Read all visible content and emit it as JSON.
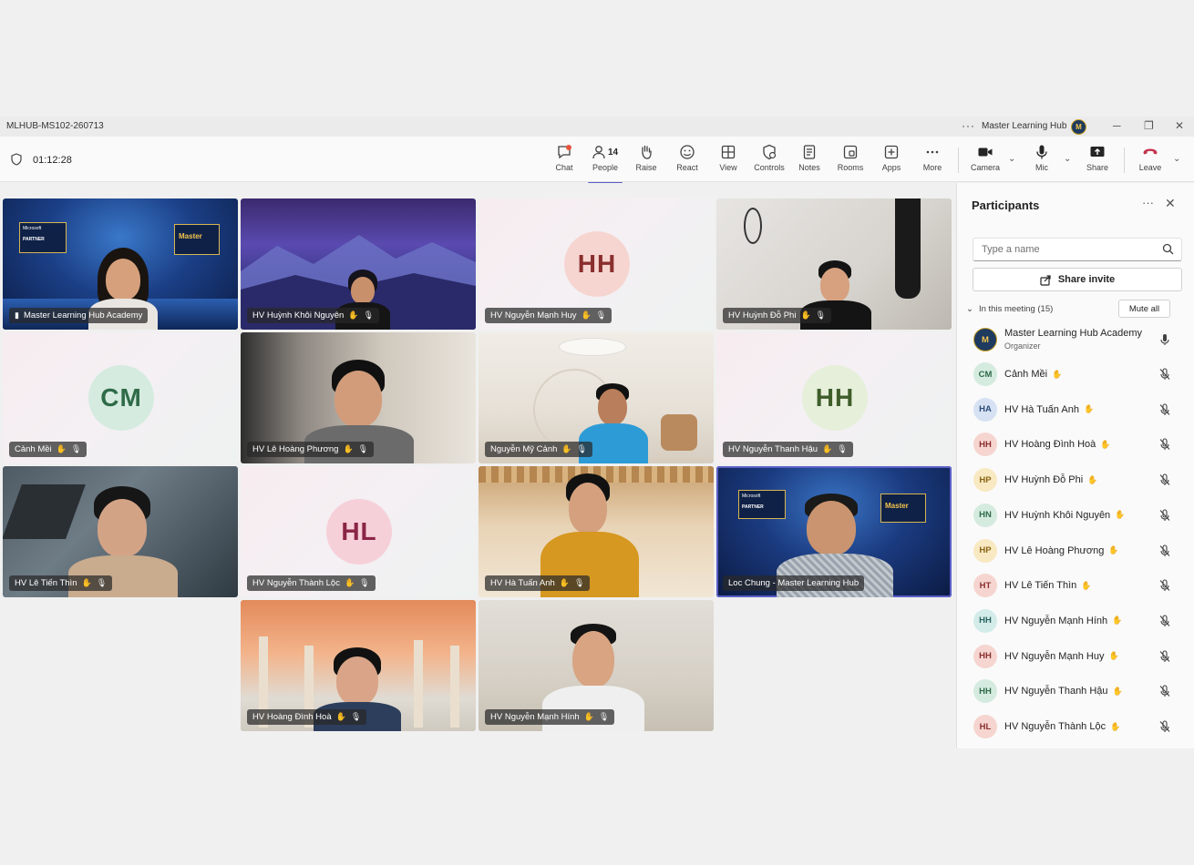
{
  "window": {
    "title": "MLHUB-MS102-260713",
    "org_name": "Master Learning Hub",
    "org_avatar": "M"
  },
  "toolbar": {
    "timer": "01:12:28",
    "buttons": [
      {
        "id": "chat",
        "label": "Chat",
        "icon": "chat-icon"
      },
      {
        "id": "people",
        "label": "People",
        "icon": "people-icon",
        "count": "14"
      },
      {
        "id": "raise",
        "label": "Raise",
        "icon": "hand-icon"
      },
      {
        "id": "react",
        "label": "React",
        "icon": "smile-icon"
      },
      {
        "id": "view",
        "label": "View",
        "icon": "grid-icon"
      },
      {
        "id": "controls",
        "label": "Controls",
        "icon": "controls-icon"
      },
      {
        "id": "notes",
        "label": "Notes",
        "icon": "notes-icon"
      },
      {
        "id": "rooms",
        "label": "Rooms",
        "icon": "rooms-icon"
      },
      {
        "id": "apps",
        "label": "Apps",
        "icon": "apps-icon"
      },
      {
        "id": "more",
        "label": "More",
        "icon": "more-icon"
      },
      {
        "id": "camera",
        "label": "Camera",
        "icon": "camera-icon"
      },
      {
        "id": "mic",
        "label": "Mic",
        "icon": "mic-icon"
      },
      {
        "id": "share",
        "label": "Share",
        "icon": "share-icon"
      },
      {
        "id": "leave",
        "label": "Leave",
        "icon": "phone-hangup-icon"
      }
    ]
  },
  "stage": {
    "tiles": [
      {
        "name": "Master Learning Hub Academy"
      },
      {
        "name": "HV Huỳnh Khôi Nguyên"
      },
      {
        "name": "HV Nguyễn Mạnh Huy",
        "initials": "HH"
      },
      {
        "name": "HV Huỳnh Đỗ Phi"
      },
      {
        "name": "Cảnh Mềi",
        "initials": "CM"
      },
      {
        "name": "HV Lê Hoàng Phương"
      },
      {
        "name": "Nguyễn Mỹ Cảnh"
      },
      {
        "name": "HV Nguyễn Thanh Hậu",
        "initials": "HH"
      },
      {
        "name": "HV Lê Tiến Thìn"
      },
      {
        "name": "HV Nguyễn Thành Lộc",
        "initials": "HL"
      },
      {
        "name": "HV Hà Tuấn Anh"
      },
      {
        "name": "Loc Chung - Master Learning Hub"
      },
      {
        "name": "HV Hoàng Đình Hoà"
      },
      {
        "name": "HV Nguyễn Mạnh Hính"
      }
    ],
    "backdrop_text": {
      "microsoft": "Microsoft",
      "partner": "PARTNER",
      "brand": "Master"
    }
  },
  "participants": {
    "title": "Participants",
    "search_placeholder": "Type a name",
    "share_invite": "Share invite",
    "in_meeting_label": "In this meeting (15)",
    "mute_all": "Mute all",
    "list": [
      {
        "initials": "M",
        "name": "Master Learning Hub Academy",
        "role": "Organizer"
      },
      {
        "initials": "CM",
        "name": "Cảnh Mềi"
      },
      {
        "initials": "HA",
        "name": "HV Hà Tuấn Anh"
      },
      {
        "initials": "HH",
        "name": "HV Hoàng Đình Hoà"
      },
      {
        "initials": "HP",
        "name": "HV Huỳnh Đỗ Phi"
      },
      {
        "initials": "HN",
        "name": "HV Huỳnh Khôi Nguyên"
      },
      {
        "initials": "HP",
        "name": "HV Lê Hoàng Phương"
      },
      {
        "initials": "HT",
        "name": "HV Lê Tiến Thìn"
      },
      {
        "initials": "HH",
        "name": "HV Nguyễn Mạnh Hính"
      },
      {
        "initials": "HH",
        "name": "HV Nguyễn Mạnh Huy"
      },
      {
        "initials": "HH",
        "name": "HV Nguyễn Thanh Hậu"
      },
      {
        "initials": "HL",
        "name": "HV Nguyễn Thành Lộc"
      }
    ]
  },
  "colors": {
    "accent": "#5b5fc7",
    "leave": "#c4314b",
    "avatar_green_bg": "#d5ebdf",
    "avatar_green_fg": "#2f6b49",
    "avatar_pink_bg": "#f6d5d0",
    "avatar_pink_fg": "#8a2e2e",
    "avatar_blue_bg": "#d6e2f3",
    "avatar_blue_fg": "#2c4d7a",
    "avatar_yellow_bg": "#f9e9c2",
    "avatar_yellow_fg": "#8a6414",
    "avatar_teal_bg": "#d3ecea",
    "avatar_teal_fg": "#2a6460"
  }
}
